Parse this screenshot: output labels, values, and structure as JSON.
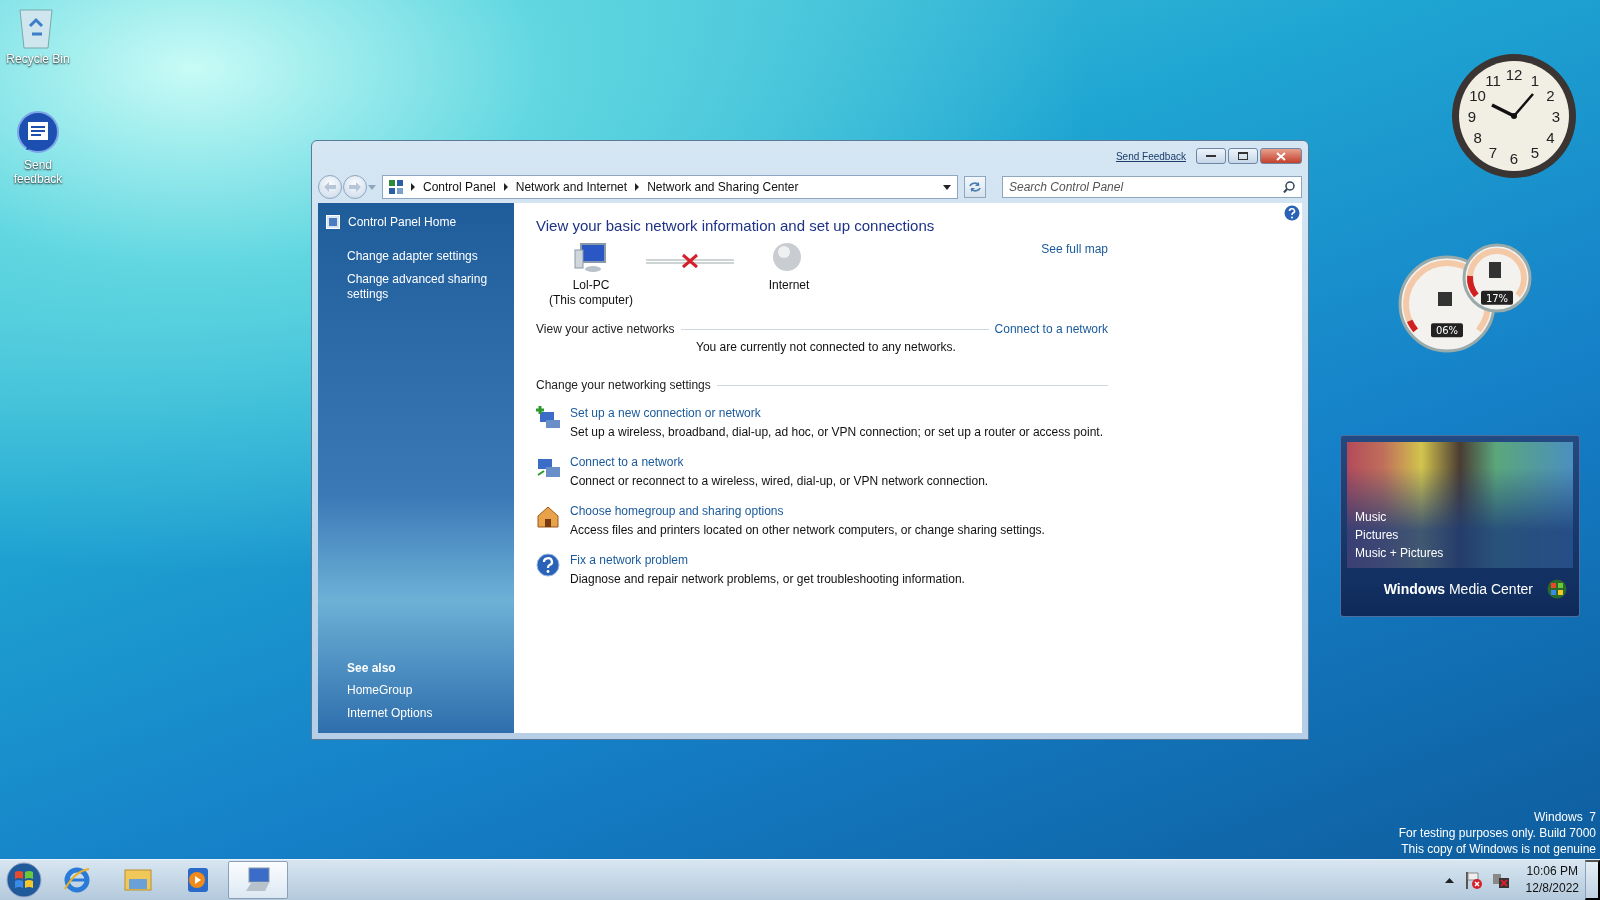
{
  "desktop_icons": [
    {
      "kind": "recycle-bin",
      "label": "Recycle Bin"
    },
    {
      "kind": "feedback",
      "label": "Send feedback"
    }
  ],
  "window": {
    "send_feedback": "Send Feedback",
    "breadcrumb": [
      "Control Panel",
      "Network and Internet",
      "Network and Sharing Center"
    ],
    "search": {
      "placeholder": "Search Control Panel"
    },
    "sidebar": {
      "home": "Control Panel Home",
      "links": [
        "Change adapter settings",
        "Change advanced sharing settings"
      ],
      "see_also_title": "See also",
      "see_also": [
        "HomeGroup",
        "Internet Options"
      ]
    },
    "main": {
      "heading": "View your basic network information and set up connections",
      "map": {
        "nodes": [
          {
            "kind": "computer",
            "label": "Lol-PC",
            "sublabel": "(This computer)"
          },
          {
            "kind": "globe",
            "label": "Internet"
          }
        ],
        "connected": false
      },
      "see_full_map": "See full map",
      "active_networks": {
        "title": "View your active networks",
        "link": "Connect to a network",
        "message": "You are currently not connected to any networks."
      },
      "settings_title": "Change your networking settings",
      "tasks": [
        {
          "kind": "new-connection",
          "link": "Set up a new connection or network",
          "description": "Set up a wireless, broadband, dial-up, ad hoc, or VPN connection; or set up a router or access point."
        },
        {
          "kind": "connect",
          "link": "Connect to a network",
          "description": "Connect or reconnect to a wireless, wired, dial-up, or VPN network connection."
        },
        {
          "kind": "homegroup",
          "link": "Choose homegroup and sharing options",
          "description": "Access files and printers located on other network computers, or change sharing settings."
        },
        {
          "kind": "troubleshoot",
          "link": "Fix a network problem",
          "description": "Diagnose and repair network problems, or get troubleshooting information."
        }
      ]
    }
  },
  "gadgets": {
    "clock": {
      "numerals": [
        "12",
        "11",
        "1",
        "10",
        "2",
        "9",
        "3",
        "8",
        "4",
        "7",
        "5",
        "6"
      ]
    },
    "meters": [
      {
        "kind": "cpu",
        "reading": "06%",
        "level": 0.06
      },
      {
        "kind": "memory",
        "reading": "17%",
        "level": 0.17
      }
    ],
    "media_center": {
      "items": [
        "Music",
        "Pictures",
        "Music + Pictures"
      ],
      "brand": "**Windows** Media Center"
    }
  },
  "os_notice": [
    "Windows  7",
    "For testing purposes only. Build 7000",
    "This copy of Windows is not genuine"
  ],
  "taskbar": {
    "apps": [
      {
        "kind": "browser",
        "active": false
      },
      {
        "kind": "folder",
        "active": false
      },
      {
        "kind": "media-player",
        "active": false
      },
      {
        "kind": "network-center",
        "active": true
      }
    ],
    "time": "10:06 PM",
    "date": "12/8/2022"
  }
}
